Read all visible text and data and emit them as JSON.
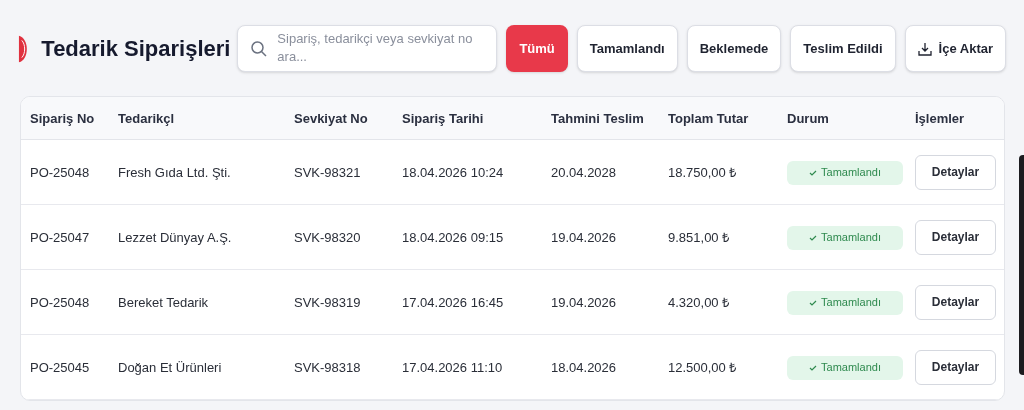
{
  "header": {
    "title": "Tedarik Siparişleri"
  },
  "search": {
    "placeholder": "Sipariş, tedarikçi veya sevkiyat no ara..."
  },
  "filters": [
    {
      "label": "Tümü",
      "selected": true
    },
    {
      "label": "Tamamlandı",
      "selected": false
    },
    {
      "label": "Beklemede",
      "selected": false
    },
    {
      "label": "Teslim Edildi",
      "selected": false
    }
  ],
  "import_button": {
    "label": "İçe Aktar"
  },
  "table": {
    "columns": [
      "Sipariş No",
      "Tedarikçl",
      "Sevkiyat No",
      "Sipariş Tarihi",
      "Tahmini Teslim",
      "Toplam Tutar",
      "Durum",
      "İşlemler"
    ],
    "rows": [
      {
        "order_no": "PO-25048",
        "supplier": "Fresh Gıda Ltd. Şti.",
        "shipment_no": "SVK-98321",
        "order_date": "18.04.2026 10:24",
        "delivery": "20.04.2028",
        "total": "18.750,00 ₺",
        "status": "Tamamlandı",
        "action": "Detaylar"
      },
      {
        "order_no": "PO-25047",
        "supplier": "Lezzet Dünyay A.Ş.",
        "shipment_no": "SVK-98320",
        "order_date": "18.04.2026 09:15",
        "delivery": "19.04.2026",
        "total": "9.851,00 ₺",
        "status": "Tamamlandı",
        "action": "Detaylar"
      },
      {
        "order_no": "PO-25048",
        "supplier": "Bereket Tedarik",
        "shipment_no": "SVK-98319",
        "order_date": "17.04.2026 16:45",
        "delivery": "19.04.2026",
        "total": "4.320,00 ₺",
        "status": "Tamamlandı",
        "action": "Detaylar"
      },
      {
        "order_no": "PO-25045",
        "supplier": "Doğan Et Ürünleri",
        "shipment_no": "SVK-98318",
        "order_date": "17.04.2026 11:10",
        "delivery": "18.04.2026",
        "total": "12.500,00 ₺",
        "status": "Tamamlandı",
        "action": "Detaylar"
      }
    ]
  }
}
